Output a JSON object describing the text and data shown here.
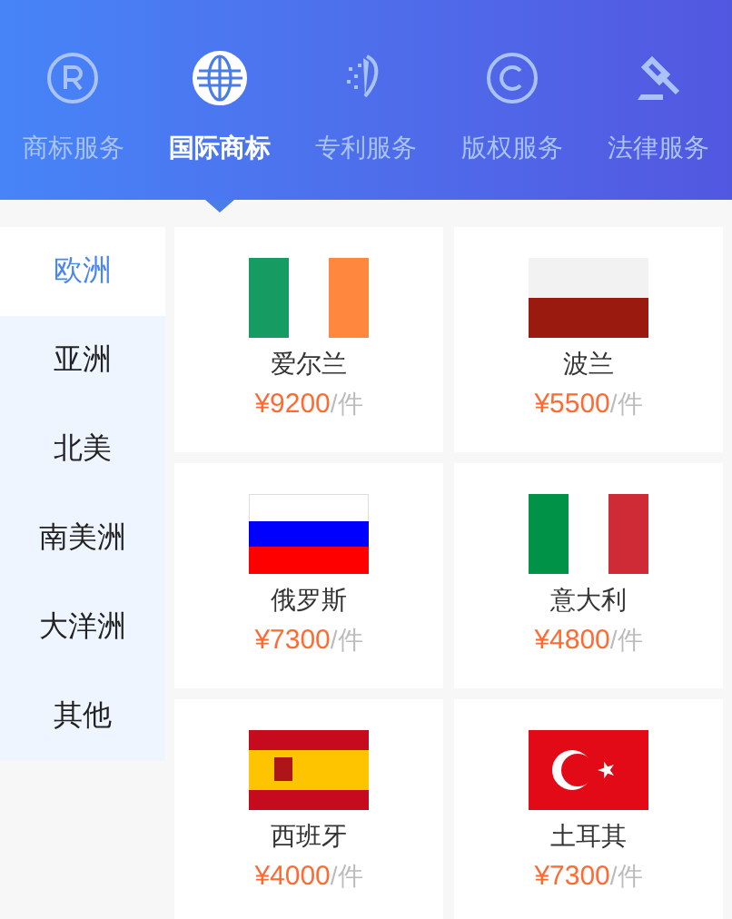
{
  "tabs": [
    {
      "label": "商标服务",
      "selected": false
    },
    {
      "label": "国际商标",
      "selected": true
    },
    {
      "label": "专利服务",
      "selected": false
    },
    {
      "label": "版权服务",
      "selected": false
    },
    {
      "label": "法律服务",
      "selected": false
    }
  ],
  "sidebar": {
    "items": [
      {
        "label": "欧洲",
        "selected": true
      },
      {
        "label": "亚洲",
        "selected": false
      },
      {
        "label": "北美",
        "selected": false
      },
      {
        "label": "南美洲",
        "selected": false
      },
      {
        "label": "大洋洲",
        "selected": false
      },
      {
        "label": "其他",
        "selected": false
      }
    ]
  },
  "countries": [
    {
      "name": "爱尔兰",
      "price": "¥9200",
      "unit": "/件"
    },
    {
      "name": "波兰",
      "price": "¥5500",
      "unit": "/件"
    },
    {
      "name": "俄罗斯",
      "price": "¥7300",
      "unit": "/件"
    },
    {
      "name": "意大利",
      "price": "¥4800",
      "unit": "/件"
    },
    {
      "name": "西班牙",
      "price": "¥4000",
      "unit": "/件"
    },
    {
      "name": "土耳其",
      "price": "¥7300",
      "unit": "/件"
    }
  ]
}
